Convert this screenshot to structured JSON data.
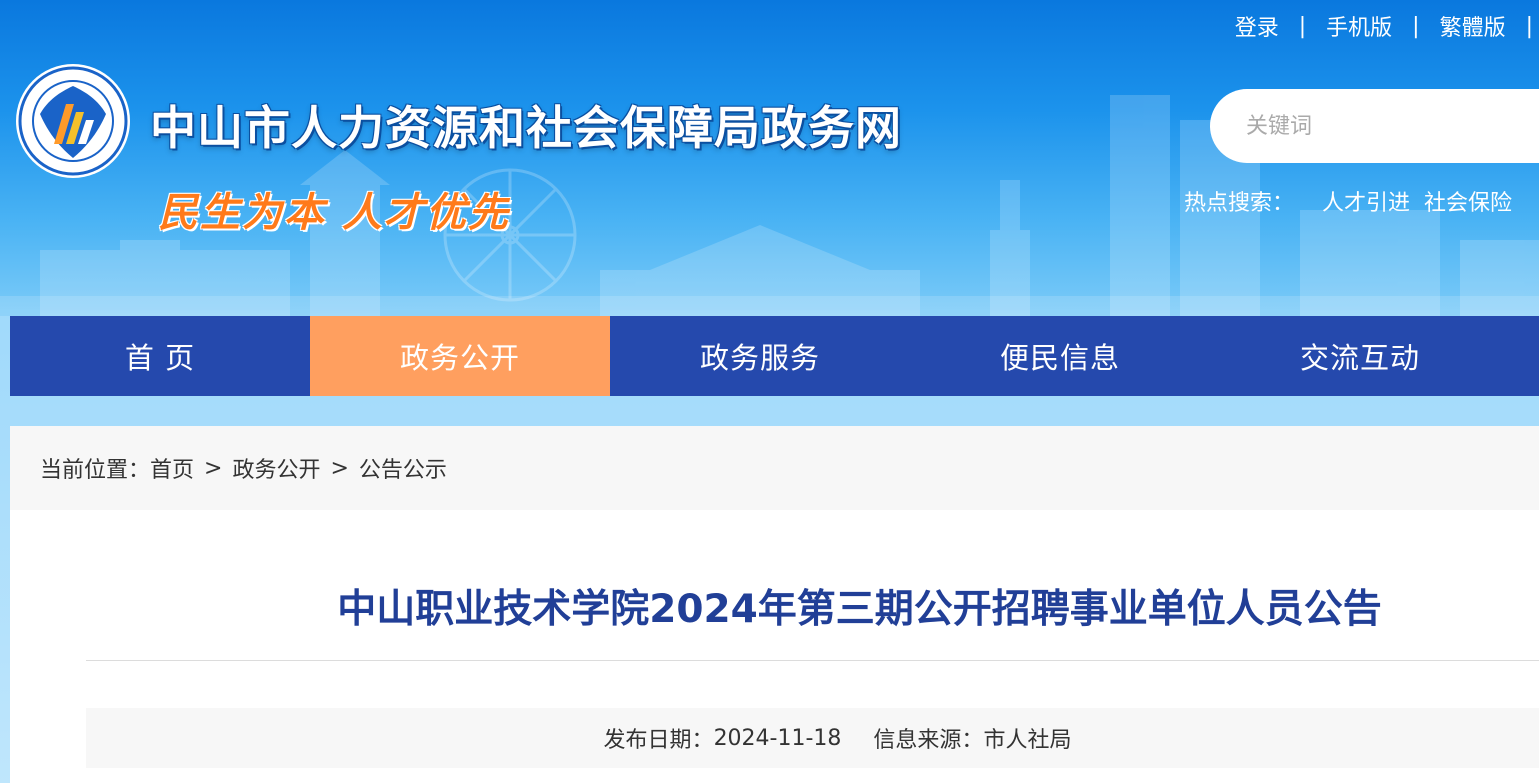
{
  "header": {
    "site_title": "中山市人力资源和社会保障局政务网",
    "slogan": "民生为本 人才优先",
    "top_links": [
      "登录",
      "手机版",
      "繁體版"
    ],
    "search": {
      "placeholder": "关键词"
    },
    "hot_search": {
      "label": "热点搜索：",
      "keywords": [
        "人才引进",
        "社会保险"
      ]
    }
  },
  "nav": {
    "items": [
      "首 页",
      "政务公开",
      "政务服务",
      "便民信息",
      "交流互动"
    ],
    "active_index": 1
  },
  "breadcrumb": {
    "label": "当前位置：",
    "items": [
      "首页",
      "政务公开",
      "公告公示"
    ],
    "separator": ">"
  },
  "article": {
    "title": "中山职业技术学院2024年第三期公开招聘事业单位人员公告",
    "publish_label": "发布日期：",
    "publish_date": "2024-11-18",
    "source_label": "信息来源：",
    "source": "市人社局"
  },
  "colors": {
    "nav_bg": "#2549ad",
    "nav_active": "#ff9f5f",
    "title_color": "#213f97",
    "slogan_color": "#ff7a1a"
  }
}
